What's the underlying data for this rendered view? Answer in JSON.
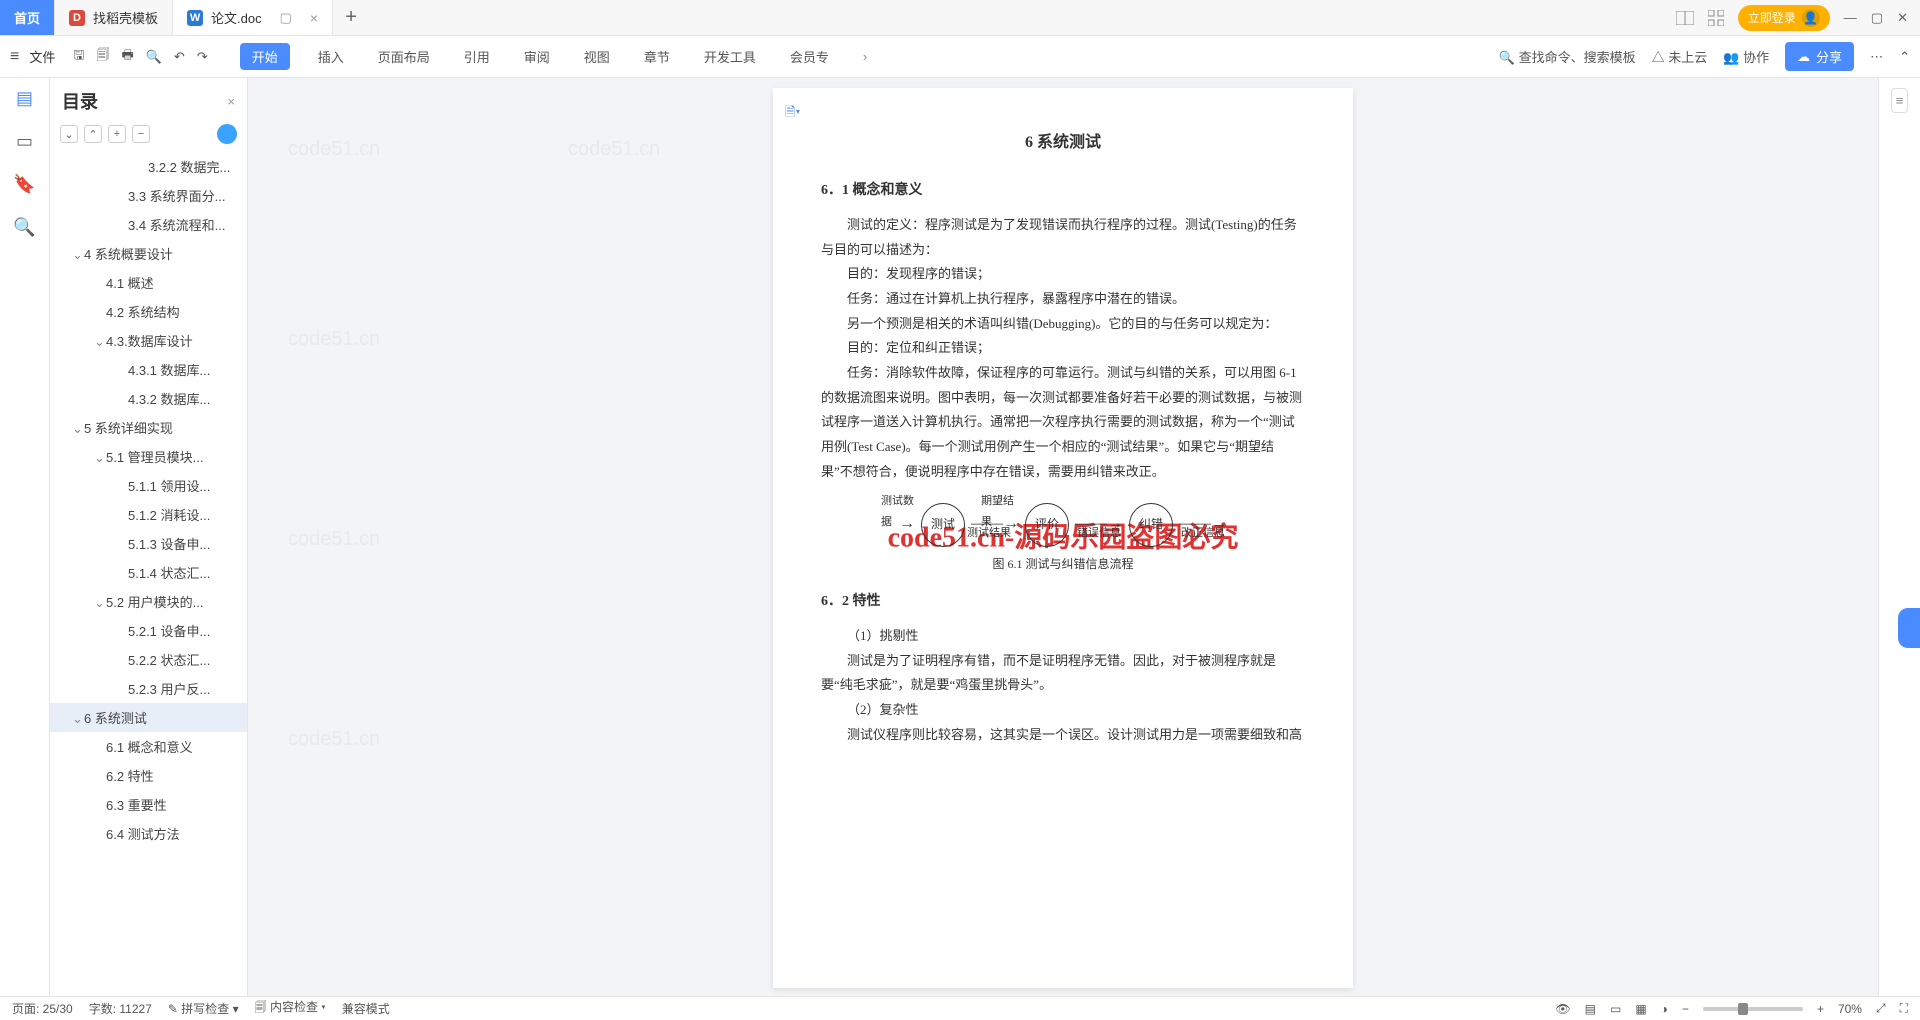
{
  "tabs": {
    "home": "首页",
    "t1": "找稻壳模板",
    "t2": "论文.doc"
  },
  "titlebar": {
    "login": "立即登录"
  },
  "filemenu": "文件",
  "ribbon": {
    "start": "开始",
    "insert": "插入",
    "pagelayout": "页面布局",
    "reference": "引用",
    "review": "审阅",
    "view": "视图",
    "chapter": "章节",
    "devtools": "开发工具",
    "member": "会员专",
    "search": "查找命令、搜索模板",
    "cloud": "未上云",
    "collab": "协作",
    "share": "分享"
  },
  "outline": {
    "title": "目录",
    "items": [
      {
        "lv": 4,
        "chev": "",
        "label": "3.2.2 数据完..."
      },
      {
        "lv": 3,
        "chev": "",
        "label": "3.3 系统界面分..."
      },
      {
        "lv": 3,
        "chev": "",
        "label": "3.4 系统流程和..."
      },
      {
        "lv": 1,
        "chev": "⌄",
        "label": "4 系统概要设计"
      },
      {
        "lv": 2,
        "chev": "",
        "label": "4.1 概述"
      },
      {
        "lv": 2,
        "chev": "",
        "label": "4.2 系统结构"
      },
      {
        "lv": 2,
        "chev": "⌄",
        "label": "4.3.数据库设计"
      },
      {
        "lv": 3,
        "chev": "",
        "label": "4.3.1 数据库..."
      },
      {
        "lv": 3,
        "chev": "",
        "label": "4.3.2 数据库..."
      },
      {
        "lv": 1,
        "chev": "⌄",
        "label": "5 系统详细实现"
      },
      {
        "lv": 2,
        "chev": "⌄",
        "label": "5.1 管理员模块..."
      },
      {
        "lv": 3,
        "chev": "",
        "label": "5.1.1 领用设..."
      },
      {
        "lv": 3,
        "chev": "",
        "label": "5.1.2 消耗设..."
      },
      {
        "lv": 3,
        "chev": "",
        "label": "5.1.3 设备申..."
      },
      {
        "lv": 3,
        "chev": "",
        "label": "5.1.4 状态汇..."
      },
      {
        "lv": 2,
        "chev": "⌄",
        "label": "5.2 用户模块的..."
      },
      {
        "lv": 3,
        "chev": "",
        "label": "5.2.1 设备申..."
      },
      {
        "lv": 3,
        "chev": "",
        "label": "5.2.2 状态汇..."
      },
      {
        "lv": 3,
        "chev": "",
        "label": "5.2.3 用户反..."
      },
      {
        "lv": 1,
        "chev": "⌄",
        "label": "6 系统测试",
        "sel": true
      },
      {
        "lv": 2,
        "chev": "",
        "label": "6.1 概念和意义"
      },
      {
        "lv": 2,
        "chev": "",
        "label": "6.2 特性"
      },
      {
        "lv": 2,
        "chev": "",
        "label": "6.3 重要性"
      },
      {
        "lv": 2,
        "chev": "",
        "label": "6.4 测试方法"
      }
    ]
  },
  "doc": {
    "h_ch6": "6 系统测试",
    "h_61": "6．1 概念和意义",
    "p1": "测试的定义：程序测试是为了发现错误而执行程序的过程。测试(Testing)的任务与目的可以描述为：",
    "p2": "目的：发现程序的错误；",
    "p3": "任务：通过在计算机上执行程序，暴露程序中潜在的错误。",
    "p4": "另一个预测是相关的术语叫纠错(Debugging)。它的目的与任务可以规定为：",
    "p5": "目的：定位和纠正错误；",
    "p6": "任务：消除软件故障，保证程序的可靠运行。测试与纠错的关系，可以用图 6-1 的数据流图来说明。图中表明，每一次测试都要准备好若干必要的测试数据，与被测试程序一道送入计算机执行。通常把一次程序执行需要的测试数据，称为一个“测试用例(Test Case)。每一个测试用例产生一个相应的“测试结果”。如果它与“期望结果”不想符合，便说明程序中存在错误，需要用纠错来改正。",
    "fig_in": "测试数据",
    "fig_exp": "期望结果",
    "n1": "测试",
    "n2": "评价",
    "n3": "纠错",
    "e1": "测试结果",
    "e2": "错误信息",
    "e3": "改正信息",
    "figcap": "图 6.1 测试与纠错信息流程",
    "h_62": "6．2 特性",
    "p7": "（1）挑剔性",
    "p8": "测试是为了证明程序有错，而不是证明程序无错。因此，对于被测程序就是要“纯毛求疵”，就是要“鸡蛋里挑骨头”。",
    "p9": "（2）复杂性",
    "p10": "测试仪程序则比较容易，这其实是一个误区。设计测试用力是一项需要细致和高"
  },
  "overlay": "code51.cn-源码乐园盗图必究",
  "wm": "code51.cn",
  "status": {
    "page": "页面: 25/30",
    "words": "字数: 11227",
    "spell": "拼写检查",
    "content": "内容检查",
    "compat": "兼容模式",
    "zoom": "70%"
  }
}
